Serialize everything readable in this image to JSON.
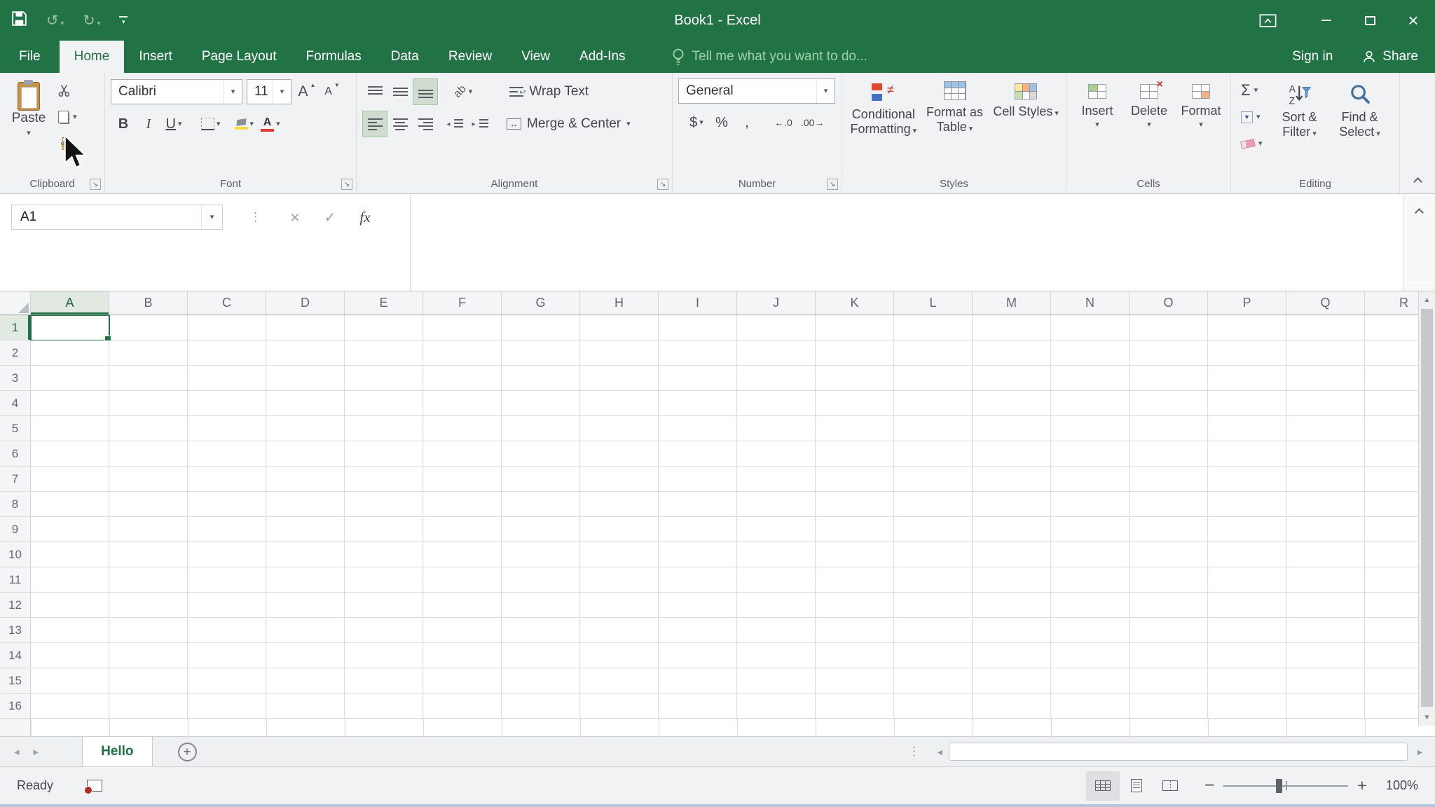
{
  "window": {
    "title": "Book1 - Excel"
  },
  "menu_tabs": {
    "file": "File",
    "home": "Home",
    "insert": "Insert",
    "page_layout": "Page Layout",
    "formulas": "Formulas",
    "data": "Data",
    "review": "Review",
    "view": "View",
    "add_ins": "Add-Ins"
  },
  "tell_me": "Tell me what you want to do...",
  "account": {
    "sign_in": "Sign in",
    "share": "Share"
  },
  "ribbon": {
    "clipboard": {
      "group_label": "Clipboard",
      "paste": "Paste"
    },
    "font": {
      "group_label": "Font",
      "font_name": "Calibri",
      "font_size": "11",
      "bold": "B",
      "italic": "I",
      "underline": "U"
    },
    "alignment": {
      "group_label": "Alignment",
      "wrap_text": "Wrap Text",
      "merge_center": "Merge & Center"
    },
    "number": {
      "group_label": "Number",
      "format": "General",
      "currency": "$",
      "percent": "%",
      "comma": ","
    },
    "styles": {
      "group_label": "Styles",
      "conditional_formatting": "Conditional Formatting",
      "format_as_table": "Format as Table",
      "cell_styles": "Cell Styles"
    },
    "cells": {
      "group_label": "Cells",
      "insert": "Insert",
      "delete": "Delete",
      "format": "Format"
    },
    "editing": {
      "group_label": "Editing",
      "sort_filter": "Sort & Filter",
      "find_select": "Find & Select"
    }
  },
  "formula_bar": {
    "name_box": "A1",
    "fx": "fx",
    "value": ""
  },
  "grid": {
    "columns": [
      "A",
      "B",
      "C",
      "D",
      "E",
      "F",
      "G",
      "H",
      "I",
      "J",
      "K",
      "L",
      "M",
      "N",
      "O",
      "P",
      "Q",
      "R"
    ],
    "rows": [
      "1",
      "2",
      "3",
      "4",
      "5",
      "6",
      "7",
      "8",
      "9",
      "10",
      "11",
      "12",
      "13",
      "14",
      "15",
      "16"
    ],
    "selected_cell": "A1",
    "selected_column": "A",
    "selected_row": "1"
  },
  "sheet_bar": {
    "active_sheet": "Hello"
  },
  "status_bar": {
    "mode": "Ready",
    "zoom": "100%"
  },
  "icons": {
    "caret_down": "▾",
    "undo": "↺",
    "redo": "↻",
    "check": "✓",
    "cancel": "×",
    "close": "×",
    "dots_vertical": "⋮",
    "launcher": "↘",
    "up_arrow": "▲",
    "down_arrow": "▼",
    "left_tri": "◂",
    "right_tri": "▸",
    "sigma": "Σ",
    "not_equal": "≠",
    "left_right_arrow": "↔",
    "return_arrow": "↩",
    "orientation_ab": "ab",
    "letter_a": "A",
    "increase_decimal": "←.0",
    "decrease_decimal": ".00→",
    "minus": "−",
    "plus": "+"
  },
  "colors": {
    "accent_green": "#217346",
    "selection_border": "#217346"
  }
}
